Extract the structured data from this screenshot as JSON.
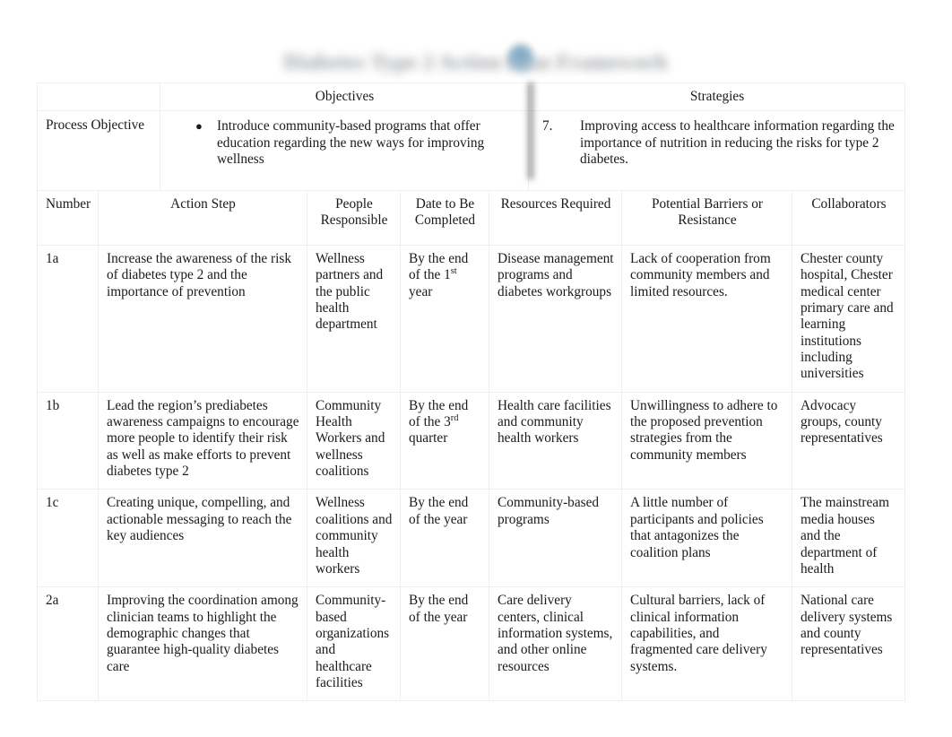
{
  "document": {
    "heading_redacted_text": "Diabetes Type 2 Action Plan Framework",
    "heading_is_blurred": true,
    "background_color": "#ffffff",
    "text_color": "#1a1a1a",
    "border_color": "#efefef"
  },
  "objectives_table": {
    "headers": {
      "corner": "",
      "objectives": "Objectives",
      "strategies": "Strategies"
    },
    "row": {
      "label": "Process Objective",
      "objective_marker": "●",
      "objective_text": "Introduce community-based programs that offer education regarding the new ways for improving wellness",
      "strategy_marker": "7.",
      "strategy_text": "Improving access to healthcare information regarding the importance of nutrition in reducing the risks for type 2 diabetes."
    }
  },
  "action_table": {
    "headers": [
      "Number",
      "Action Step",
      "People Responsible",
      "Date to Be Completed",
      "Resources Required",
      "Potential Barriers or Resistance",
      "Collaborators"
    ],
    "rows": [
      {
        "number": "1a",
        "action_step": "Increase the awareness of the risk of diabetes type 2 and the importance of prevention",
        "people_responsible": "Wellness partners and the public health department",
        "date_prefix": "By the end of the 1",
        "date_sup": "st",
        "date_suffix": " year",
        "resources_required": "Disease management programs and diabetes workgroups",
        "potential_barriers": "Lack of cooperation from community members and limited resources.",
        "collaborators": "Chester county hospital, Chester medical center primary care and learning institutions including universities"
      },
      {
        "number": "1b",
        "action_step": "Lead the region’s prediabetes awareness campaigns to encourage more people to identify their risk as well as make efforts to prevent diabetes type 2",
        "people_responsible": "Community Health Workers and wellness coalitions",
        "date_prefix": "By the end of the 3",
        "date_sup": "rd",
        "date_suffix": " quarter",
        "resources_required": "Health care facilities and community health workers",
        "potential_barriers": "Unwillingness to adhere to the proposed prevention strategies from the community members",
        "collaborators": "Advocacy groups, county representatives"
      },
      {
        "number": "1c",
        "action_step": "Creating unique, compelling, and actionable messaging to reach the key audiences",
        "people_responsible": "Wellness coalitions and community health workers",
        "date_prefix": "By the end of the year",
        "date_sup": "",
        "date_suffix": "",
        "resources_required": "Community-based programs",
        "potential_barriers": "A little number of participants and policies that antagonizes the coalition plans",
        "collaborators": "The mainstream media houses and the department of health"
      },
      {
        "number": "2a",
        "action_step": "Improving the coordination among clinician teams to highlight the demographic changes that guarantee high-quality diabetes care",
        "people_responsible": "Community-based organizations and healthcare facilities",
        "date_prefix": "By the end of the year",
        "date_sup": "",
        "date_suffix": "",
        "resources_required": "Care delivery centers, clinical information systems, and other online resources",
        "potential_barriers": "Cultural barriers, lack of clinical information capabilities, and fragmented care delivery systems.",
        "collaborators": "National care delivery systems and county representatives"
      }
    ]
  }
}
